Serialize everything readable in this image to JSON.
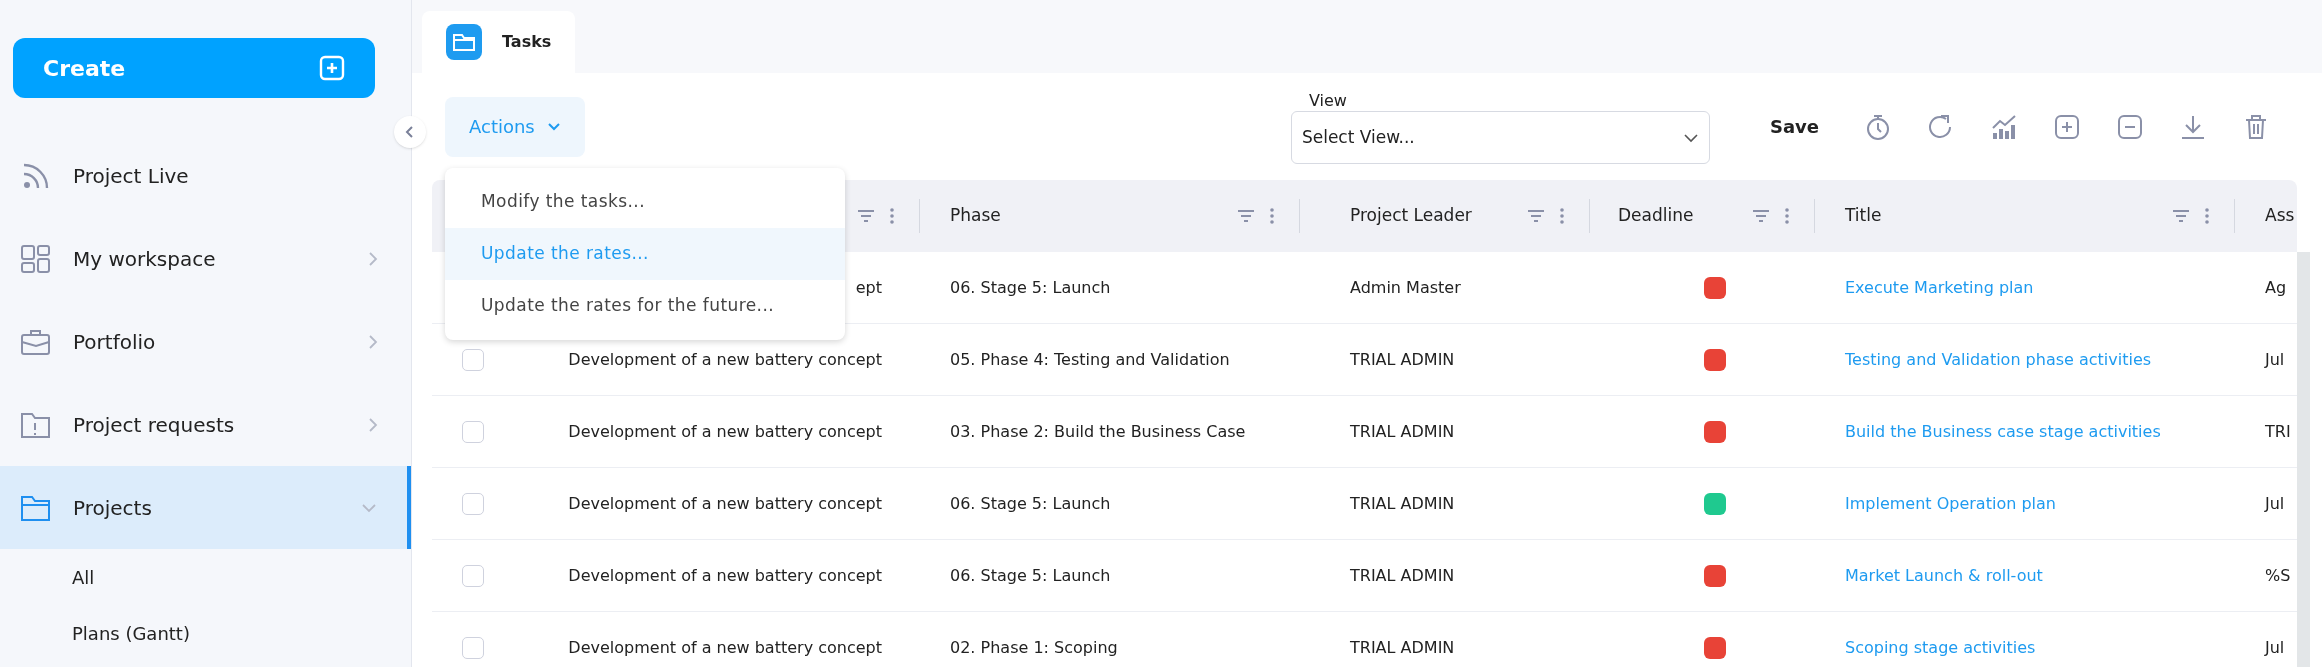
{
  "sidebar": {
    "create_button": "Create",
    "items": [
      {
        "label": "Project Live",
        "selected": false
      },
      {
        "label": "My workspace",
        "selected": false,
        "expanded": false
      },
      {
        "label": "Portfolio",
        "selected": false,
        "expanded": false
      },
      {
        "label": "Project requests",
        "selected": false,
        "expanded": false
      },
      {
        "label": "Projects",
        "selected": true,
        "expanded": true,
        "children": [
          {
            "label": "All"
          },
          {
            "label": "Plans (Gantt)"
          }
        ]
      }
    ]
  },
  "tabs": [
    {
      "label": "Tasks",
      "selected": true
    }
  ],
  "toolbar": {
    "actions_button": "Actions",
    "view_field": {
      "label": "View",
      "value": "Select View..."
    },
    "save_button": "Save"
  },
  "actions_menu": {
    "items": [
      {
        "label": "Modify the tasks...",
        "selected": false
      },
      {
        "label": "Update the rates...",
        "selected": true
      },
      {
        "label": "Update the rates for the future...",
        "selected": false
      }
    ]
  },
  "table": {
    "columns": [
      {},
      {
        "label": "Phase"
      },
      {
        "label": "Project Leader"
      },
      {
        "label": "Deadline"
      },
      {
        "label": "Title"
      },
      {
        "label": "Ass"
      }
    ],
    "rows": [
      {
        "project": "ept",
        "phase": "06. Stage 5: Launch",
        "leader": "Admin Master",
        "color": "#e84337",
        "title": "Execute Marketing plan",
        "column_6": "Ag"
      },
      {
        "checked": false,
        "project": "Development of a new battery concept",
        "phase": "05. Phase 4: Testing and Validation",
        "leader": "TRIAL ADMIN",
        "color": "#e84337",
        "title": "Testing and Validation phase activities",
        "column_6": "Jul"
      },
      {
        "checked": false,
        "project": "Development of a new battery concept",
        "phase": "03. Phase 2: Build the Business Case",
        "leader": "TRIAL ADMIN",
        "color": "#e84337",
        "title": "Build the Business case stage activities",
        "column_6": "TRI"
      },
      {
        "checked": false,
        "project": "Development of a new battery concept",
        "phase": "06. Stage 5: Launch",
        "leader": "TRIAL ADMIN",
        "color": "#1fc98f",
        "title": "Implement Operation plan",
        "column_6": "Jul"
      },
      {
        "checked": false,
        "project": "Development of a new battery concept",
        "phase": "06. Stage 5: Launch",
        "leader": "TRIAL ADMIN",
        "color": "#e84337",
        "title": "Market Launch & roll-out",
        "column_6": "%S"
      },
      {
        "checked": false,
        "project": "Development of a new battery concept",
        "phase": "02. Phase 1: Scoping",
        "leader": "TRIAL ADMIN",
        "color": "#e84337",
        "title": "Scoping stage activities",
        "column_6": "Jul"
      }
    ]
  }
}
